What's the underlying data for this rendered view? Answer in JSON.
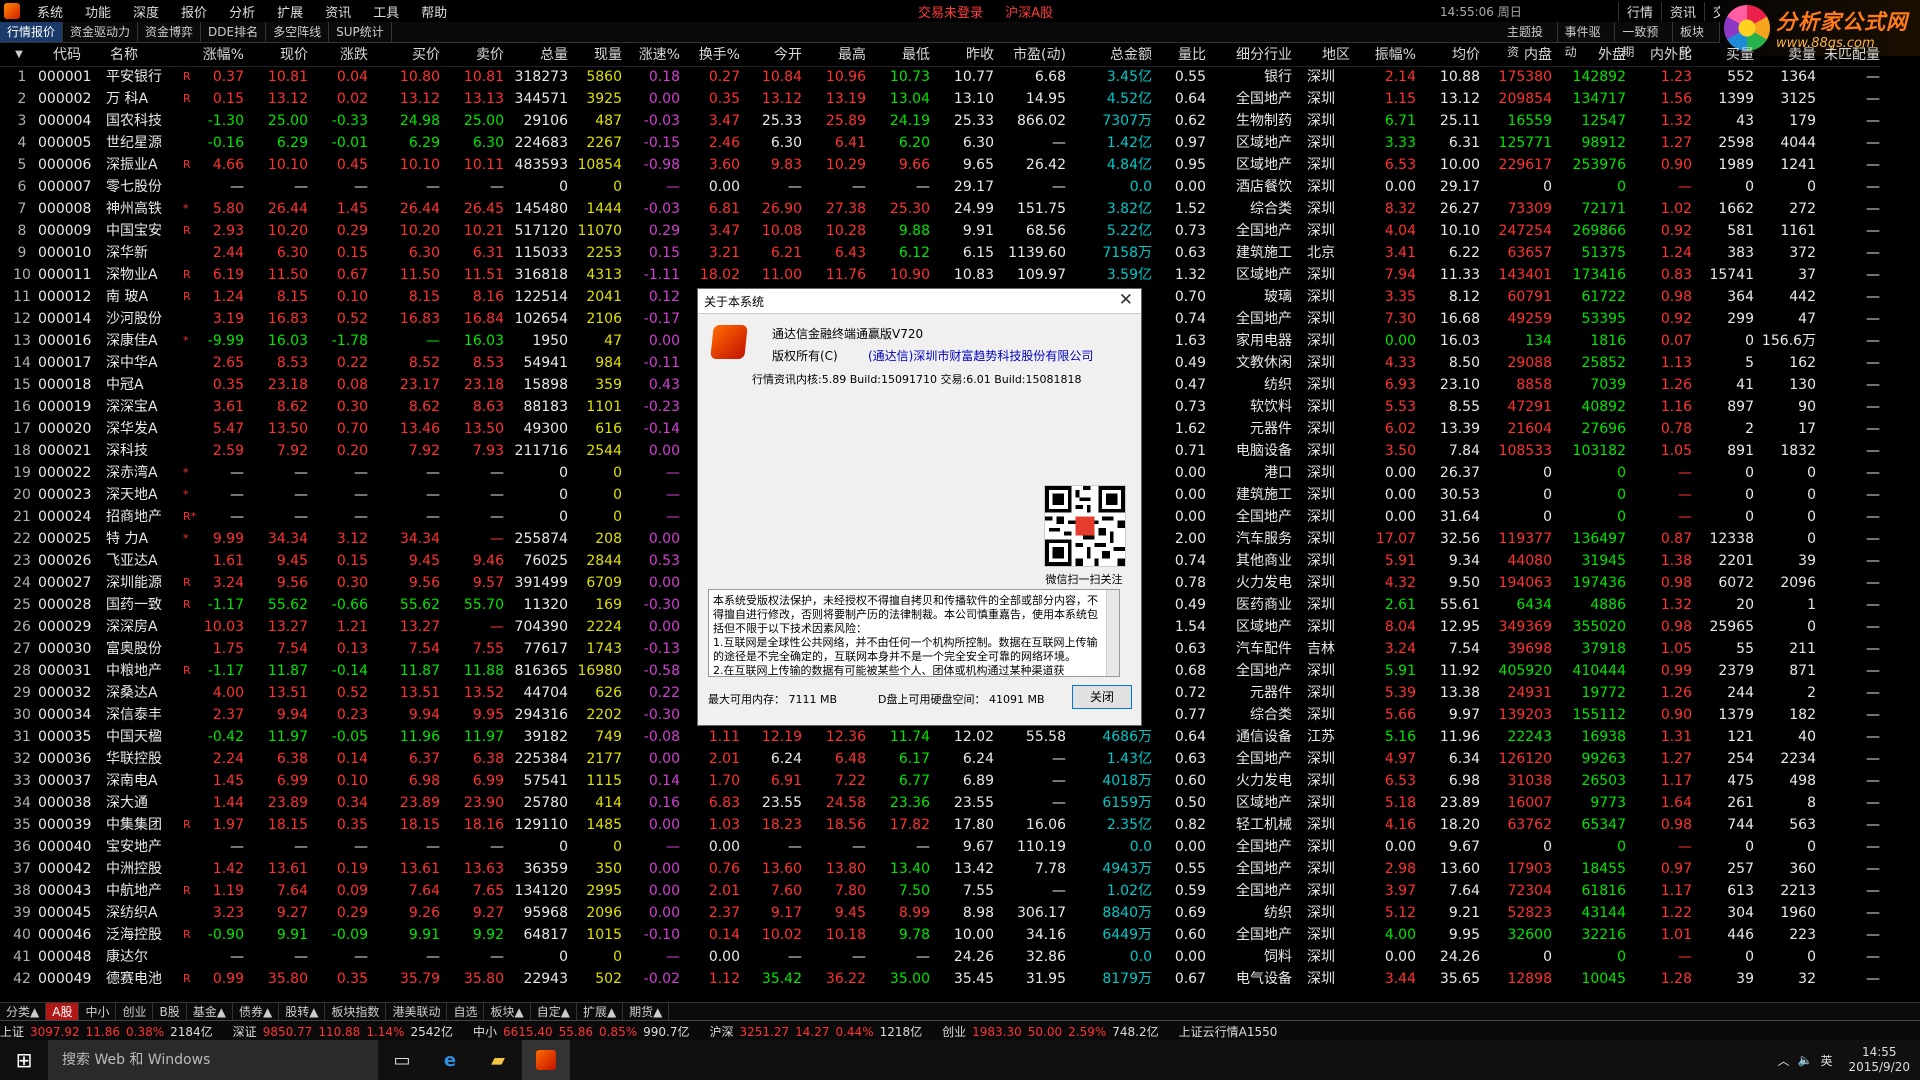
{
  "menu": [
    "系统",
    "功能",
    "深度",
    "报价",
    "分析",
    "扩展",
    "资讯",
    "工具",
    "帮助"
  ],
  "status": {
    "trade": "交易未登录",
    "market": "沪深A股",
    "clock": "14:55:06 周日"
  },
  "right_buttons": [
    "行情",
    "资讯",
    "交"
  ],
  "logo": {
    "title": "分析家公式网",
    "url": "www.88gs.com"
  },
  "tabs": [
    "行情报价",
    "资金驱动力",
    "资金博弈",
    "DDE排名",
    "多空阵线",
    "SUP统计"
  ],
  "right_tabs": [
    "主题投资",
    "事件驱动",
    "一致预期",
    "板块轮"
  ],
  "headers": [
    "代码",
    "名称",
    "涨幅%",
    "现价",
    "涨跌",
    "买价",
    "卖价",
    "总量",
    "现量",
    "涨速%",
    "换手%",
    "今开",
    "最高",
    "最低",
    "昨收",
    "市盈(动)",
    "总金额",
    "量比",
    "细分行业",
    "地区",
    "振幅%",
    "均价",
    "内盘",
    "外盘",
    "内外比",
    "买量",
    "卖量",
    "未匹配量"
  ],
  "rows": [
    [
      "1",
      "000001",
      "平安银行",
      "R",
      "0.37",
      "10.81",
      "0.04",
      "10.80",
      "10.81",
      "318273",
      "5860",
      "0.18",
      "0.27",
      "10.84",
      "10.96",
      "10.73",
      "10.77",
      "6.68",
      "3.45亿",
      "0.55",
      "银行",
      "深圳",
      "2.14",
      "10.88",
      "175380",
      "142892",
      "1.23",
      "552",
      "1364",
      "—"
    ],
    [
      "2",
      "000002",
      "万 科A",
      "R",
      "0.15",
      "13.12",
      "0.02",
      "13.12",
      "13.13",
      "344571",
      "3925",
      "0.00",
      "0.35",
      "13.12",
      "13.19",
      "13.04",
      "13.10",
      "14.95",
      "4.52亿",
      "0.64",
      "全国地产",
      "深圳",
      "1.15",
      "13.12",
      "209854",
      "134717",
      "1.56",
      "1399",
      "3125",
      "—"
    ],
    [
      "3",
      "000004",
      "国农科技",
      "",
      "-1.30",
      "25.00",
      "-0.33",
      "24.98",
      "25.00",
      "29106",
      "487",
      "-0.03",
      "3.47",
      "25.33",
      "25.89",
      "24.19",
      "25.33",
      "866.02",
      "7307万",
      "0.62",
      "生物制药",
      "深圳",
      "6.71",
      "25.11",
      "16559",
      "12547",
      "1.32",
      "43",
      "179",
      "—"
    ],
    [
      "4",
      "000005",
      "世纪星源",
      "",
      "-0.16",
      "6.29",
      "-0.01",
      "6.29",
      "6.30",
      "224683",
      "2267",
      "-0.15",
      "2.46",
      "6.30",
      "6.41",
      "6.20",
      "6.30",
      "—",
      "1.42亿",
      "0.97",
      "区域地产",
      "深圳",
      "3.33",
      "6.31",
      "125771",
      "98912",
      "1.27",
      "2598",
      "4044",
      "—"
    ],
    [
      "5",
      "000006",
      "深振业A",
      "R",
      "4.66",
      "10.10",
      "0.45",
      "10.10",
      "10.11",
      "483593",
      "10854",
      "-0.98",
      "3.60",
      "9.83",
      "10.29",
      "9.66",
      "9.65",
      "26.42",
      "4.84亿",
      "0.95",
      "区域地产",
      "深圳",
      "6.53",
      "10.00",
      "229617",
      "253976",
      "0.90",
      "1989",
      "1241",
      "—"
    ],
    [
      "6",
      "000007",
      "零七股份",
      "",
      "—",
      "—",
      "—",
      "—",
      "—",
      "0",
      "0",
      "—",
      "0.00",
      "—",
      "—",
      "—",
      "29.17",
      "—",
      "0.0",
      "0.00",
      "酒店餐饮",
      "深圳",
      "0.00",
      "29.17",
      "0",
      "0",
      "—",
      "0",
      "0",
      "—"
    ],
    [
      "7",
      "000008",
      "神州高铁",
      "*",
      "5.80",
      "26.44",
      "1.45",
      "26.44",
      "26.45",
      "145480",
      "1444",
      "-0.03",
      "6.81",
      "26.90",
      "27.38",
      "25.30",
      "24.99",
      "151.75",
      "3.82亿",
      "1.52",
      "综合类",
      "深圳",
      "8.32",
      "26.27",
      "73309",
      "72171",
      "1.02",
      "1662",
      "272",
      "—"
    ],
    [
      "8",
      "000009",
      "中国宝安",
      "R",
      "2.93",
      "10.20",
      "0.29",
      "10.20",
      "10.21",
      "517120",
      "11070",
      "0.29",
      "3.47",
      "10.08",
      "10.28",
      "9.88",
      "9.91",
      "68.56",
      "5.22亿",
      "0.73",
      "全国地产",
      "深圳",
      "4.04",
      "10.10",
      "247254",
      "269866",
      "0.92",
      "581",
      "1161",
      "—"
    ],
    [
      "9",
      "000010",
      "深华新",
      "",
      "2.44",
      "6.30",
      "0.15",
      "6.30",
      "6.31",
      "115033",
      "2253",
      "0.15",
      "3.21",
      "6.21",
      "6.43",
      "6.12",
      "6.15",
      "1139.60",
      "7158万",
      "0.63",
      "建筑施工",
      "北京",
      "3.41",
      "6.22",
      "63657",
      "51375",
      "1.24",
      "383",
      "372",
      "—"
    ],
    [
      "10",
      "000011",
      "深物业A",
      "R",
      "6.19",
      "11.50",
      "0.67",
      "11.50",
      "11.51",
      "316818",
      "4313",
      "-1.11",
      "18.02",
      "11.00",
      "11.76",
      "10.90",
      "10.83",
      "109.97",
      "3.59亿",
      "1.32",
      "区域地产",
      "深圳",
      "7.94",
      "11.33",
      "143401",
      "173416",
      "0.83",
      "15741",
      "37",
      "—"
    ],
    [
      "11",
      "000012",
      "南 玻A",
      "R",
      "1.24",
      "8.15",
      "0.10",
      "8.15",
      "8.16",
      "122514",
      "2041",
      "0.12",
      "",
      "",
      "",
      "",
      "",
      "",
      "",
      "0.70",
      "玻璃",
      "深圳",
      "3.35",
      "8.12",
      "60791",
      "61722",
      "0.98",
      "364",
      "442",
      "—"
    ],
    [
      "12",
      "000014",
      "沙河股份",
      "",
      "3.19",
      "16.83",
      "0.52",
      "16.83",
      "16.84",
      "102654",
      "2106",
      "-0.17",
      "",
      "",
      "",
      "",
      "",
      "",
      "",
      "0.74",
      "全国地产",
      "深圳",
      "7.30",
      "16.68",
      "49259",
      "53395",
      "0.92",
      "299",
      "47",
      "—"
    ],
    [
      "13",
      "000016",
      "深康佳A",
      "*",
      "-9.99",
      "16.03",
      "-1.78",
      "—",
      "16.03",
      "1950",
      "47",
      "0.00",
      "",
      "",
      "",
      "",
      "",
      "",
      "",
      "1.63",
      "家用电器",
      "深圳",
      "0.00",
      "16.03",
      "134",
      "1816",
      "0.07",
      "0",
      "156.6万",
      "—"
    ],
    [
      "14",
      "000017",
      "深中华A",
      "",
      "2.65",
      "8.53",
      "0.22",
      "8.52",
      "8.53",
      "54941",
      "984",
      "-0.11",
      "",
      "",
      "",
      "",
      "",
      "",
      "",
      "0.49",
      "文教休闲",
      "深圳",
      "4.33",
      "8.50",
      "29088",
      "25852",
      "1.13",
      "5",
      "162",
      "—"
    ],
    [
      "15",
      "000018",
      "中冠A",
      "",
      "0.35",
      "23.18",
      "0.08",
      "23.17",
      "23.18",
      "15898",
      "359",
      "0.43",
      "",
      "",
      "",
      "",
      "",
      "",
      "",
      "0.47",
      "纺织",
      "深圳",
      "6.93",
      "23.10",
      "8858",
      "7039",
      "1.26",
      "41",
      "130",
      "—"
    ],
    [
      "16",
      "000019",
      "深深宝A",
      "",
      "3.61",
      "8.62",
      "0.30",
      "8.62",
      "8.63",
      "88183",
      "1101",
      "-0.23",
      "",
      "",
      "",
      "",
      "",
      "",
      "",
      "0.73",
      "软饮料",
      "深圳",
      "5.53",
      "8.55",
      "47291",
      "40892",
      "1.16",
      "897",
      "90",
      "—"
    ],
    [
      "17",
      "000020",
      "深华发A",
      "",
      "5.47",
      "13.50",
      "0.70",
      "13.46",
      "13.50",
      "49300",
      "616",
      "-0.14",
      "",
      "",
      "",
      "",
      "",
      "",
      "",
      "1.62",
      "元器件",
      "深圳",
      "6.02",
      "13.39",
      "21604",
      "27696",
      "0.78",
      "2",
      "17",
      "—"
    ],
    [
      "18",
      "000021",
      "深科技",
      "",
      "2.59",
      "7.92",
      "0.20",
      "7.92",
      "7.93",
      "211716",
      "2544",
      "0.00",
      "",
      "",
      "",
      "",
      "",
      "",
      "",
      "0.71",
      "电脑设备",
      "深圳",
      "3.50",
      "7.84",
      "108533",
      "103182",
      "1.05",
      "891",
      "1832",
      "—"
    ],
    [
      "19",
      "000022",
      "深赤湾A",
      "*",
      "—",
      "—",
      "—",
      "—",
      "—",
      "0",
      "0",
      "—",
      "",
      "",
      "",
      "",
      "",
      "",
      "",
      "0.00",
      "港口",
      "深圳",
      "0.00",
      "26.37",
      "0",
      "0",
      "—",
      "0",
      "0",
      "—"
    ],
    [
      "20",
      "000023",
      "深天地A",
      "*",
      "—",
      "—",
      "—",
      "—",
      "—",
      "0",
      "0",
      "—",
      "",
      "",
      "",
      "",
      "",
      "",
      "",
      "0.00",
      "建筑施工",
      "深圳",
      "0.00",
      "30.53",
      "0",
      "0",
      "—",
      "0",
      "0",
      "—"
    ],
    [
      "21",
      "000024",
      "招商地产",
      "R*",
      "—",
      "—",
      "—",
      "—",
      "—",
      "0",
      "0",
      "—",
      "",
      "",
      "",
      "",
      "",
      "",
      "",
      "0.00",
      "全国地产",
      "深圳",
      "0.00",
      "31.64",
      "0",
      "0",
      "—",
      "0",
      "0",
      "—"
    ],
    [
      "22",
      "000025",
      "特 力A",
      "*",
      "9.99",
      "34.34",
      "3.12",
      "34.34",
      "—",
      "255874",
      "208",
      "0.00",
      "",
      "",
      "",
      "",
      "",
      "",
      "",
      "2.00",
      "汽车服务",
      "深圳",
      "17.07",
      "32.56",
      "119377",
      "136497",
      "0.87",
      "12338",
      "0",
      "—"
    ],
    [
      "23",
      "000026",
      "飞亚达A",
      "",
      "1.61",
      "9.45",
      "0.15",
      "9.45",
      "9.46",
      "76025",
      "2844",
      "0.53",
      "",
      "",
      "",
      "",
      "",
      "",
      "",
      "0.74",
      "其他商业",
      "深圳",
      "5.91",
      "9.34",
      "44080",
      "31945",
      "1.38",
      "2201",
      "39",
      "—"
    ],
    [
      "24",
      "000027",
      "深圳能源",
      "R",
      "3.24",
      "9.56",
      "0.30",
      "9.56",
      "9.57",
      "391499",
      "6709",
      "0.00",
      "",
      "",
      "",
      "",
      "",
      "",
      "",
      "0.78",
      "火力发电",
      "深圳",
      "4.32",
      "9.50",
      "194063",
      "197436",
      "0.98",
      "6072",
      "2096",
      "—"
    ],
    [
      "25",
      "000028",
      "国药一致",
      "R",
      "-1.17",
      "55.62",
      "-0.66",
      "55.62",
      "55.70",
      "11320",
      "169",
      "-0.30",
      "",
      "",
      "",
      "",
      "",
      "",
      "",
      "0.49",
      "医药商业",
      "深圳",
      "2.61",
      "55.61",
      "6434",
      "4886",
      "1.32",
      "20",
      "1",
      "—"
    ],
    [
      "26",
      "000029",
      "深深房A",
      "",
      "10.03",
      "13.27",
      "1.21",
      "13.27",
      "—",
      "704390",
      "2224",
      "0.00",
      "",
      "",
      "",
      "",
      "",
      "",
      "",
      "1.54",
      "区域地产",
      "深圳",
      "8.04",
      "12.95",
      "349369",
      "355020",
      "0.98",
      "25965",
      "0",
      "—"
    ],
    [
      "27",
      "000030",
      "富奥股份",
      "",
      "1.75",
      "7.54",
      "0.13",
      "7.54",
      "7.55",
      "77617",
      "1743",
      "-0.13",
      "",
      "",
      "",
      "",
      "",
      "",
      "",
      "0.63",
      "汽车配件",
      "吉林",
      "3.24",
      "7.54",
      "39698",
      "37918",
      "1.05",
      "55",
      "211",
      "—"
    ],
    [
      "28",
      "000031",
      "中粮地产",
      "R",
      "-1.17",
      "11.87",
      "-0.14",
      "11.87",
      "11.88",
      "816365",
      "16980",
      "-0.58",
      "",
      "",
      "",
      "",
      "",
      "",
      "",
      "0.68",
      "全国地产",
      "深圳",
      "5.91",
      "11.92",
      "405920",
      "410444",
      "0.99",
      "2379",
      "871",
      "—"
    ],
    [
      "29",
      "000032",
      "深桑达A",
      "",
      "4.00",
      "13.51",
      "0.52",
      "13.51",
      "13.52",
      "44704",
      "626",
      "0.22",
      "",
      "",
      "",
      "",
      "",
      "",
      "",
      "0.72",
      "元器件",
      "深圳",
      "5.39",
      "13.38",
      "24931",
      "19772",
      "1.26",
      "244",
      "2",
      "—"
    ],
    [
      "30",
      "000034",
      "深信泰丰",
      "",
      "2.37",
      "9.94",
      "0.23",
      "9.94",
      "9.95",
      "294316",
      "2202",
      "-0.30",
      "",
      "",
      "",
      "",
      "",
      "",
      "",
      "0.77",
      "综合类",
      "深圳",
      "5.66",
      "9.97",
      "139203",
      "155112",
      "0.90",
      "1379",
      "182",
      "—"
    ],
    [
      "31",
      "000035",
      "中国天楹",
      "",
      "-0.42",
      "11.97",
      "-0.05",
      "11.96",
      "11.97",
      "39182",
      "749",
      "-0.08",
      "1.11",
      "12.19",
      "12.36",
      "11.74",
      "12.02",
      "55.58",
      "4686万",
      "0.64",
      "通信设备",
      "江苏",
      "5.16",
      "11.96",
      "22243",
      "16938",
      "1.31",
      "121",
      "40",
      "—"
    ],
    [
      "32",
      "000036",
      "华联控股",
      "",
      "2.24",
      "6.38",
      "0.14",
      "6.37",
      "6.38",
      "225384",
      "2177",
      "0.00",
      "2.01",
      "6.24",
      "6.48",
      "6.17",
      "6.24",
      "—",
      "1.43亿",
      "0.63",
      "全国地产",
      "深圳",
      "4.97",
      "6.34",
      "126120",
      "99263",
      "1.27",
      "254",
      "2234",
      "—"
    ],
    [
      "33",
      "000037",
      "深南电A",
      "",
      "1.45",
      "6.99",
      "0.10",
      "6.98",
      "6.99",
      "57541",
      "1115",
      "0.14",
      "1.70",
      "6.91",
      "7.22",
      "6.77",
      "6.89",
      "—",
      "4018万",
      "0.60",
      "火力发电",
      "深圳",
      "6.53",
      "6.98",
      "31038",
      "26503",
      "1.17",
      "475",
      "498",
      "—"
    ],
    [
      "34",
      "000038",
      "深大通",
      "",
      "1.44",
      "23.89",
      "0.34",
      "23.89",
      "23.90",
      "25780",
      "414",
      "0.16",
      "6.83",
      "23.55",
      "24.58",
      "23.36",
      "23.55",
      "—",
      "6159万",
      "0.50",
      "区域地产",
      "深圳",
      "5.18",
      "23.89",
      "16007",
      "9773",
      "1.64",
      "261",
      "8",
      "—"
    ],
    [
      "35",
      "000039",
      "中集集团",
      "R",
      "1.97",
      "18.15",
      "0.35",
      "18.15",
      "18.16",
      "129110",
      "1485",
      "0.00",
      "1.03",
      "18.23",
      "18.56",
      "17.82",
      "17.80",
      "16.06",
      "2.35亿",
      "0.82",
      "轻工机械",
      "深圳",
      "4.16",
      "18.20",
      "63762",
      "65347",
      "0.98",
      "744",
      "563",
      "—"
    ],
    [
      "36",
      "000040",
      "宝安地产",
      "",
      "—",
      "—",
      "—",
      "—",
      "—",
      "0",
      "0",
      "—",
      "0.00",
      "—",
      "—",
      "—",
      "9.67",
      "110.19",
      "0.0",
      "0.00",
      "全国地产",
      "深圳",
      "0.00",
      "9.67",
      "0",
      "0",
      "—",
      "0",
      "0",
      "—"
    ],
    [
      "37",
      "000042",
      "中洲控股",
      "",
      "1.42",
      "13.61",
      "0.19",
      "13.61",
      "13.63",
      "36359",
      "350",
      "0.00",
      "0.76",
      "13.60",
      "13.80",
      "13.40",
      "13.42",
      "7.78",
      "4943万",
      "0.55",
      "全国地产",
      "深圳",
      "2.98",
      "13.60",
      "17903",
      "18455",
      "0.97",
      "257",
      "360",
      "—"
    ],
    [
      "38",
      "000043",
      "中航地产",
      "R",
      "1.19",
      "7.64",
      "0.09",
      "7.64",
      "7.65",
      "134120",
      "2995",
      "0.00",
      "2.01",
      "7.60",
      "7.80",
      "7.50",
      "7.55",
      "—",
      "1.02亿",
      "0.59",
      "全国地产",
      "深圳",
      "3.97",
      "7.64",
      "72304",
      "61816",
      "1.17",
      "613",
      "2213",
      "—"
    ],
    [
      "39",
      "000045",
      "深纺织A",
      "",
      "3.23",
      "9.27",
      "0.29",
      "9.26",
      "9.27",
      "95968",
      "2096",
      "0.00",
      "2.37",
      "9.17",
      "9.45",
      "8.99",
      "8.98",
      "306.17",
      "8840万",
      "0.69",
      "纺织",
      "深圳",
      "5.12",
      "9.21",
      "52823",
      "43144",
      "1.22",
      "304",
      "1960",
      "—"
    ],
    [
      "40",
      "000046",
      "泛海控股",
      "R",
      "-0.90",
      "9.91",
      "-0.09",
      "9.91",
      "9.92",
      "64817",
      "1015",
      "-0.10",
      "0.14",
      "10.02",
      "10.18",
      "9.78",
      "10.00",
      "34.16",
      "6449万",
      "0.60",
      "全国地产",
      "深圳",
      "4.00",
      "9.95",
      "32600",
      "32216",
      "1.01",
      "446",
      "223",
      "—"
    ],
    [
      "41",
      "000048",
      "康达尔",
      "",
      "—",
      "—",
      "—",
      "—",
      "—",
      "0",
      "0",
      "—",
      "0.00",
      "—",
      "—",
      "—",
      "24.26",
      "32.86",
      "0.0",
      "0.00",
      "饲料",
      "深圳",
      "0.00",
      "24.26",
      "0",
      "0",
      "—",
      "0",
      "0",
      "—"
    ],
    [
      "42",
      "000049",
      "德赛电池",
      "R",
      "0.99",
      "35.80",
      "0.35",
      "35.79",
      "35.80",
      "22943",
      "502",
      "-0.02",
      "1.12",
      "35.42",
      "36.22",
      "35.00",
      "35.45",
      "31.95",
      "8179万",
      "0.67",
      "电气设备",
      "深圳",
      "3.44",
      "35.65",
      "12898",
      "10045",
      "1.28",
      "39",
      "32",
      "—"
    ]
  ],
  "dialog": {
    "title": "关于本系统",
    "product": "通达信金融终端通赢版V720",
    "copyright": "版权所有(C)",
    "company": "(通达信)深圳市财富趋势科技股份有限公司",
    "build": "行情资讯内核:5.89 Build:15091710 交易:6.01 Build:15081818",
    "qr_caption": "微信扫一扫关注",
    "notice": "本系统受版权法保护，未经授权不得擅自拷贝和传播软件的全部或部分内容，不得擅自进行修改，否则将要制产历的法律制裁。本公司慎重嘉告，使用本系统包括但不限于以下技术因素风险：\n1.互联网是全球性公共网络，并不由任何一个机构所控制。数据在互联网上传输的途径是不完全确定的，互联网本身并不是一个完全安全可靠的网络环境。\n2.在互联网上传输的数据有可能被某些个人、团体或机构通过某种渠道获",
    "mem": "最大可用内存：  7111  MB",
    "disk": "D盘上可用硬盘空间：  41091  MB",
    "close": "关闭"
  },
  "cat_tabs": [
    "分类▲",
    "A股",
    "中小",
    "创业",
    "B股",
    "基金▲",
    "债券▲",
    "股转▲",
    "板块指数",
    "港美联动",
    "自选",
    "板块▲",
    "自定▲",
    "扩展▲",
    "期货▲"
  ],
  "index_bar": [
    {
      "label": "上证",
      "value": "3097.92",
      "chg": "11.86",
      "pct": "0.38%",
      "amt": "2184亿"
    },
    {
      "label": "深证",
      "value": "9850.77",
      "chg": "110.88",
      "pct": "1.14%",
      "amt": "2542亿"
    },
    {
      "label": "中小",
      "value": "6615.40",
      "chg": "55.86",
      "pct": "0.85%",
      "amt": "990.7亿"
    },
    {
      "label": "沪深",
      "value": "3251.27",
      "chg": "14.27",
      "pct": "0.44%",
      "amt": "1218亿"
    },
    {
      "label": "创业",
      "value": "1983.30",
      "chg": "50.00",
      "pct": "2.59%",
      "amt": "748.2亿"
    }
  ],
  "index_extra": "上证云行情A1550",
  "taskbar": {
    "search": "搜索 Web 和 Windows",
    "ime": "英",
    "time": "14:55",
    "date": "2015/9/20"
  }
}
